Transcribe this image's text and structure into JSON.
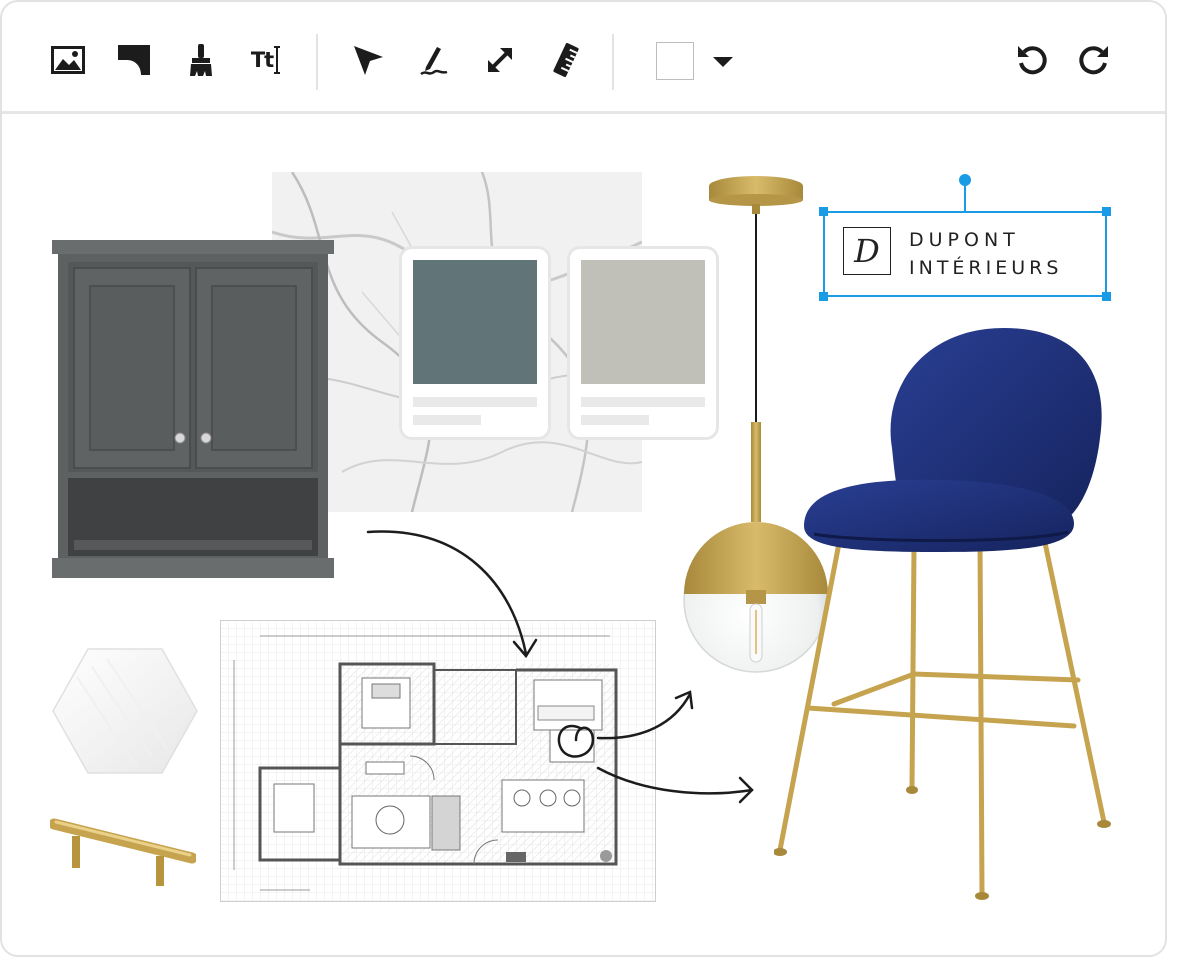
{
  "toolbar": {
    "tools": [
      {
        "name": "image-icon"
      },
      {
        "name": "shape-icon"
      },
      {
        "name": "brush-icon"
      },
      {
        "name": "text-icon",
        "label": "Tt"
      },
      {
        "name": "pointer-icon"
      },
      {
        "name": "pen-icon"
      },
      {
        "name": "resize-icon"
      },
      {
        "name": "ruler-icon"
      }
    ],
    "color_swatch": "#ffffff",
    "history": [
      {
        "name": "undo-icon"
      },
      {
        "name": "redo-icon"
      }
    ]
  },
  "canvas": {
    "palette": [
      {
        "color": "#617578"
      },
      {
        "color": "#c0bfb8"
      }
    ],
    "logo": {
      "monogram": "D",
      "line1": "DUPONT",
      "line2": "INTÉRIEURS"
    },
    "colors": {
      "selection": "#1a9be6",
      "cabinet": "#5d6061",
      "chair_velvet": "#1d2f78",
      "brass": "#c6a34f"
    }
  }
}
